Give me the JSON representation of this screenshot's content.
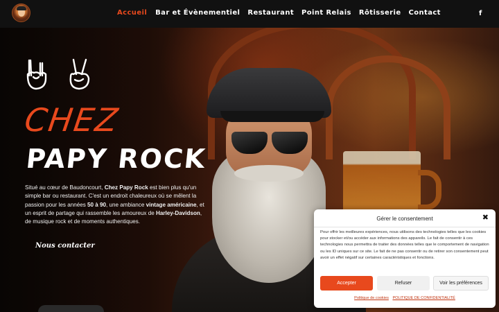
{
  "colors": {
    "accent": "#e8491d",
    "nav_text": "#ffffff",
    "header_bg": "#111111",
    "modal_bg": "#ffffff"
  },
  "header": {
    "logo_icon": "biker-logo-icon",
    "nav": [
      {
        "label": "Accueil",
        "active": true
      },
      {
        "label": "Bar et Évènementiel",
        "active": false
      },
      {
        "label": "Restaurant",
        "active": false
      },
      {
        "label": "Point Relais",
        "active": false
      },
      {
        "label": "Rôtisserie",
        "active": false
      },
      {
        "label": "Contact",
        "active": false
      }
    ],
    "social_icon": "facebook-icon",
    "social_glyph": "f"
  },
  "hero": {
    "title_line1": "CHEZ",
    "title_line2": "PAPY ROCK",
    "hand_icons": [
      "rock-hand-icon",
      "peace-hand-icon"
    ],
    "intro": {
      "p1": "Situé au cœur de Baudoncourt, ",
      "b1": "Chez Papy Rock",
      "p2": " est bien plus qu'un simple bar ou restaurant. C'est un endroit chaleureux où se mêlent la passion pour les années ",
      "b2": "50 à 90",
      "p3": ", une ambiance ",
      "b3": "vintage américaine",
      "p4": ", et un esprit de partage qui rassemble les amoureux de ",
      "b4": "Harley-Davidson",
      "p5": ", de musique rock et de moments authentiques."
    },
    "cta_label": "Nous contacter"
  },
  "consent": {
    "title": "Gérer le consentement",
    "close_glyph": "✖",
    "text": "Pour offrir les meilleures expériences, nous utilisons des technologies telles que les cookies pour stocker et/ou accéder aux informations des appareils. Le fait de consentir à ces technologies nous permettra de traiter des données telles que le comportement de navigation ou les ID uniques sur ce site. Le fait de ne pas consentir ou de retirer son consentement peut avoir un effet négatif sur certaines caractéristiques et fonctions.",
    "accept_label": "Accepter",
    "refuse_label": "Refuser",
    "prefs_label": "Voir les préférences",
    "link_cookies": "Politique de cookies",
    "link_privacy": "POLITIQUE DE CONFIDENTIALITÉ"
  }
}
